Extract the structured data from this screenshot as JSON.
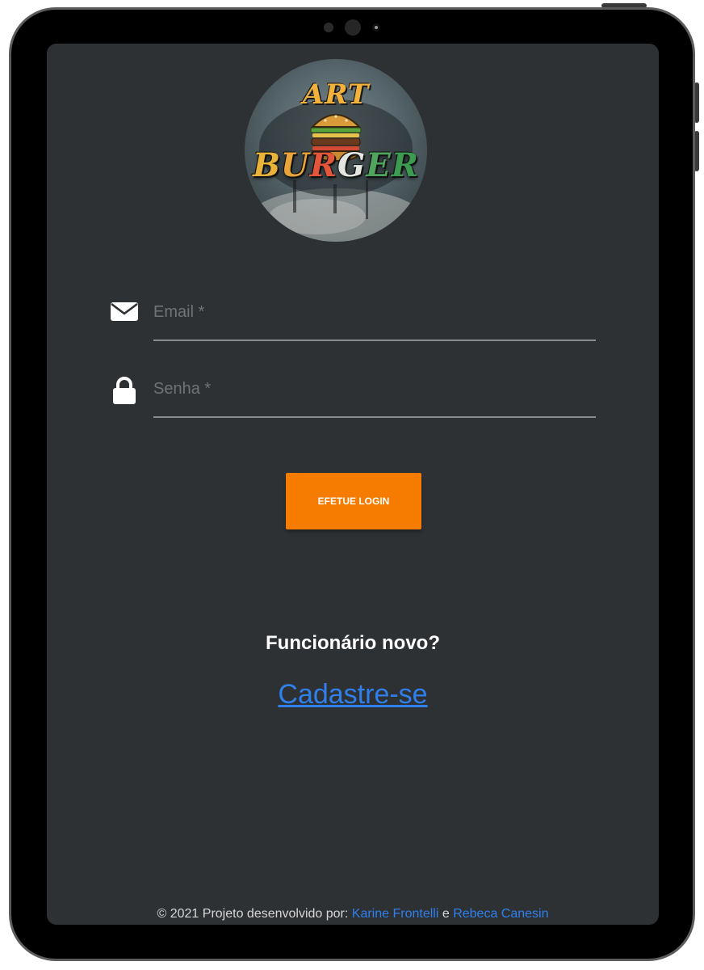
{
  "logo": {
    "line1": "ART",
    "line2": [
      "B",
      "U",
      "R",
      "G",
      "E",
      "R"
    ]
  },
  "form": {
    "email": {
      "placeholder": "Email *",
      "icon": "envelope-icon"
    },
    "password": {
      "placeholder": "Senha *",
      "icon": "lock-icon"
    },
    "login_button": "EFETUE LOGIN"
  },
  "signup": {
    "question": "Funcionário novo?",
    "link": "Cadastre-se"
  },
  "footer": {
    "prefix": "© 2021 Projeto desenvolvido por:",
    "author1": "Karine Frontelli",
    "conjunction": "e",
    "author2": "Rebeca Canesin"
  },
  "colors": {
    "screen_bg": "#2e3134",
    "accent": "#f57c00",
    "link": "#2f80ed"
  }
}
